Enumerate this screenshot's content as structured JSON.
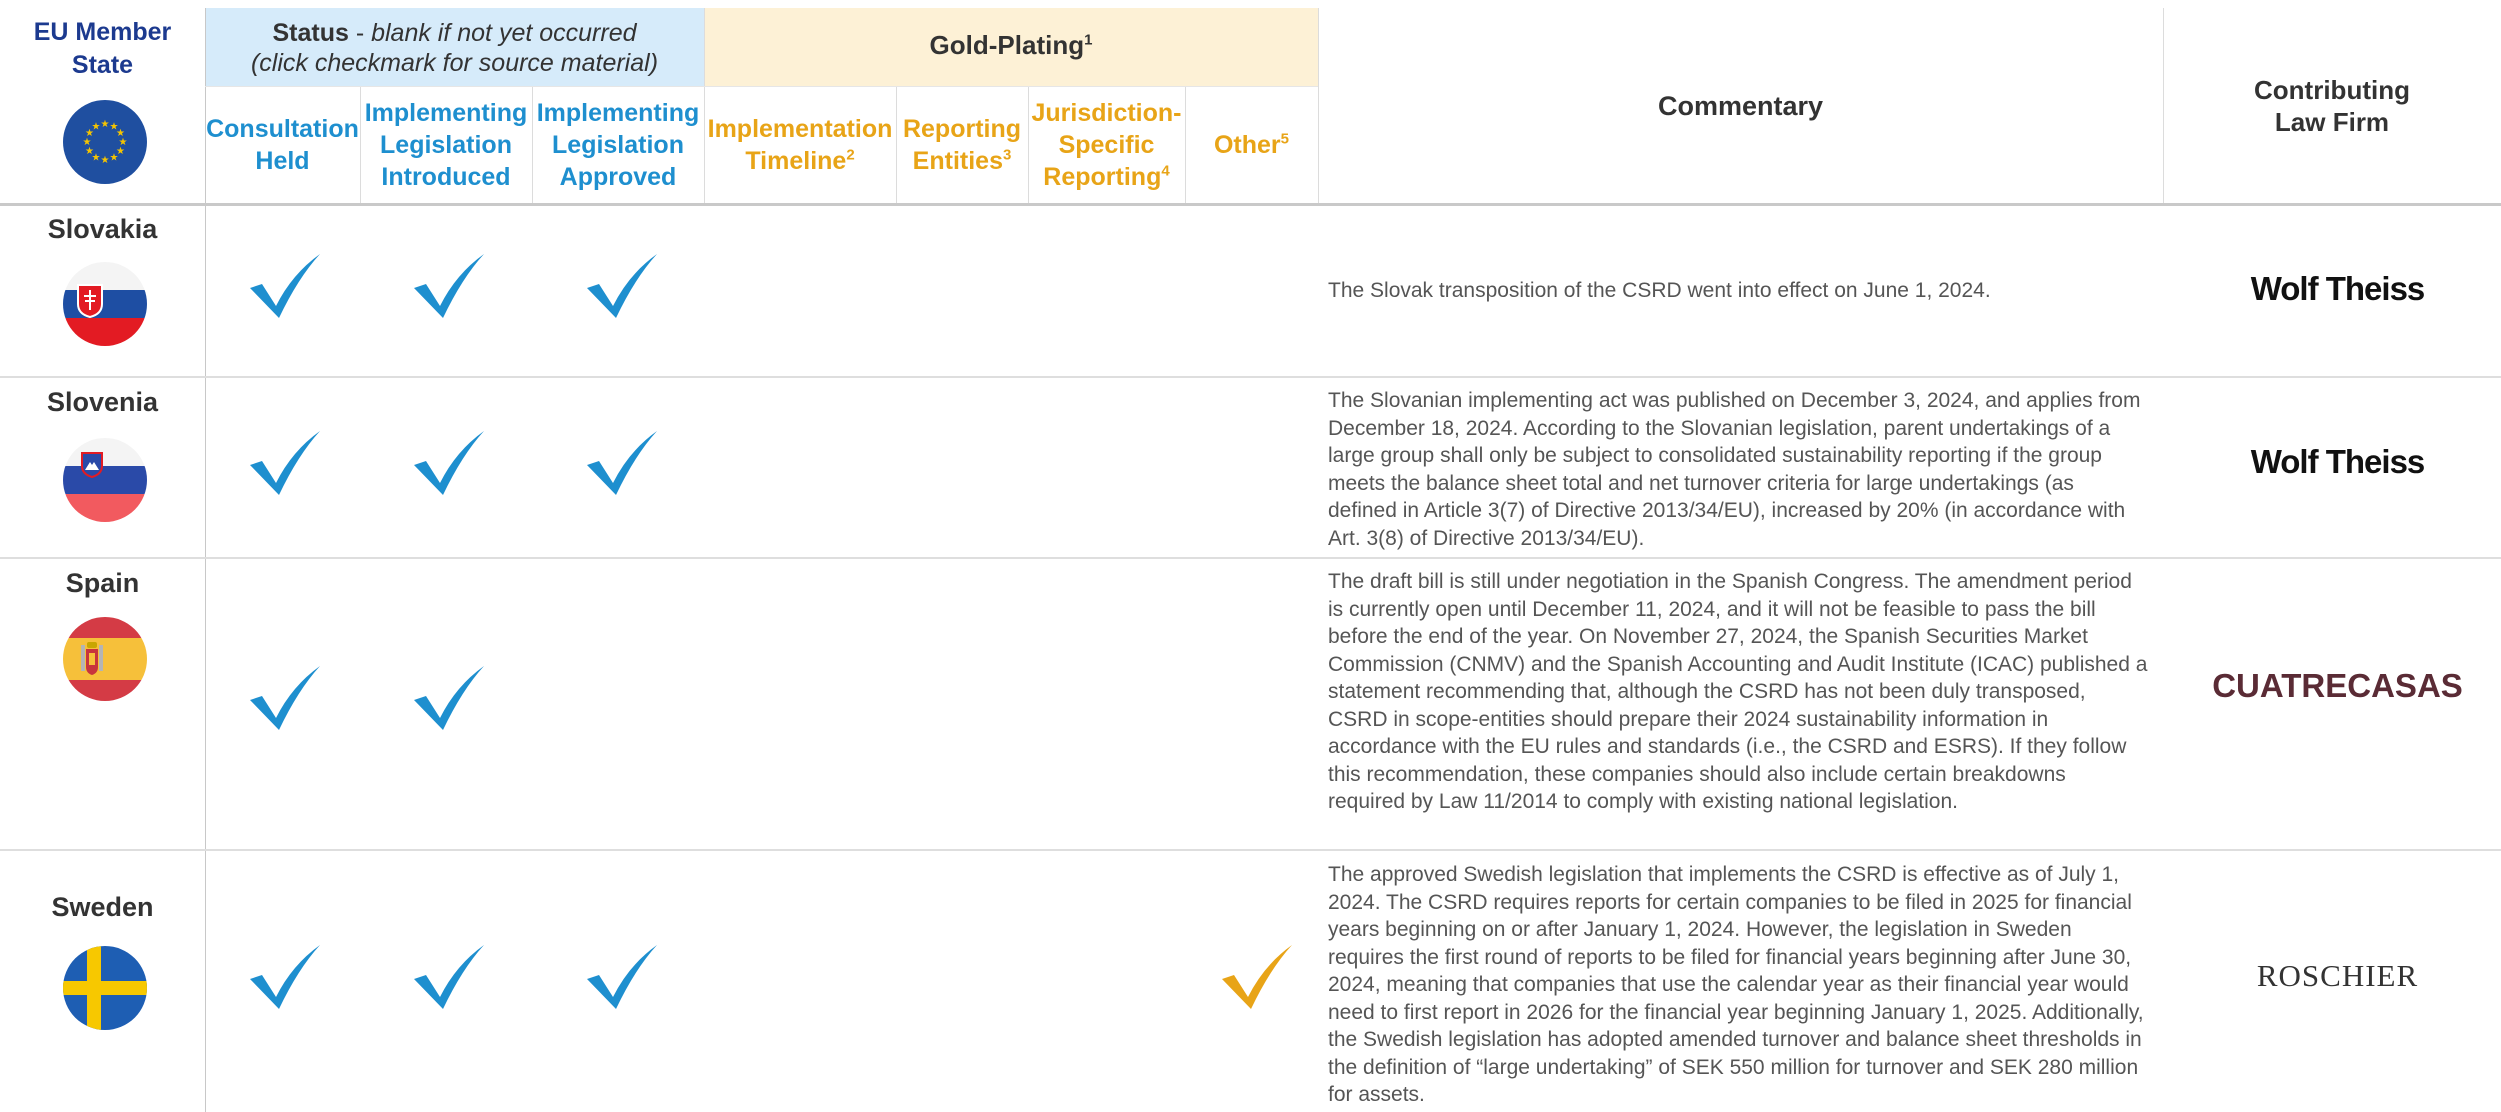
{
  "header": {
    "member_state": "EU Member State",
    "status_title": "Status",
    "status_sep": " - ",
    "status_note": "blank if not yet occurred",
    "status_note2": "(click checkmark for source material)",
    "gold_title": "Gold-Plating",
    "gold_sup": "1",
    "commentary": "Commentary",
    "law_firm": "Contributing Law Firm",
    "columns": {
      "consultation": "Consultation Held",
      "introduced": "Implementing Legislation Introduced",
      "approved": "Implementing Legislation Approved",
      "timeline": "Implementation Timeline",
      "timeline_sup": "2",
      "entities": "Reporting Entities",
      "entities_sup": "3",
      "jurisdiction": "Jurisdiction-Specific Reporting",
      "jurisdiction_sup": "4",
      "other": "Other",
      "other_sup": "5"
    }
  },
  "rows": [
    {
      "country": "Slovakia",
      "checks": {
        "consultation": true,
        "introduced": true,
        "approved": true,
        "other": false
      },
      "commentary": "The Slovak transposition of the CSRD went into effect on June 1, 2024.",
      "law_firm": "Wolf Theiss"
    },
    {
      "country": "Slovenia",
      "checks": {
        "consultation": true,
        "introduced": true,
        "approved": true,
        "other": false
      },
      "commentary": "The Slovanian implementing act was published on December 3, 2024, and applies from December 18, 2024. According to the Slovanian legislation, parent undertakings of a large group shall only be subject to consolidated sustainability reporting if the group meets the balance sheet total and net turnover criteria for large undertakings (as defined in Article 3(7) of Directive 2013/34/EU), increased by 20% (in accordance with Art. 3(8) of Directive 2013/34/EU).",
      "law_firm": "Wolf Theiss"
    },
    {
      "country": "Spain",
      "checks": {
        "consultation": true,
        "introduced": true,
        "approved": false,
        "other": false
      },
      "commentary": "The draft bill is still under negotiation in the Spanish Congress. The amendment period is currently open until December 11, 2024, and it will not be feasible to pass the bill before the end of the year. On November 27, 2024, the Spanish Securities Market Commission (CNMV) and the Spanish Accounting and Audit Institute (ICAC) published a statement recommending that, although the CSRD has not been duly transposed, CSRD in scope-entities should prepare their 2024 sustainability information in accordance with the EU rules and standards (i.e., the CSRD and ESRS). If they follow this recommendation, these companies should also include certain breakdowns required by Law 11/2014 to comply with existing national legislation.",
      "law_firm": "CUATRECASAS"
    },
    {
      "country": "Sweden",
      "checks": {
        "consultation": true,
        "introduced": true,
        "approved": true,
        "other": true
      },
      "commentary": "The approved Swedish legislation that implements the CSRD is effective as of July 1, 2024. The CSRD requires reports for certain companies to be filed in 2025 for financial years beginning on or after January 1, 2024. However, the legislation in Sweden requires the first round of reports to be filed for financial years beginning after June 30, 2024, meaning that companies that use the calendar year as their financial year would need to first report in 2026 for the financial year beginning January 1, 2025. Additionally, the Swedish legislation has adopted amended turnover and balance sheet thresholds in the definition of “large undertaking” of SEK 550 million for turnover and SEK 280 million for assets.",
      "law_firm": "ROSCHIER"
    }
  ],
  "colors": {
    "status_blue": "#1e8fcf",
    "gold": "#e8a417",
    "member_state_navy": "#1c3a8f",
    "cuatrecasas": "#5a2b35"
  }
}
